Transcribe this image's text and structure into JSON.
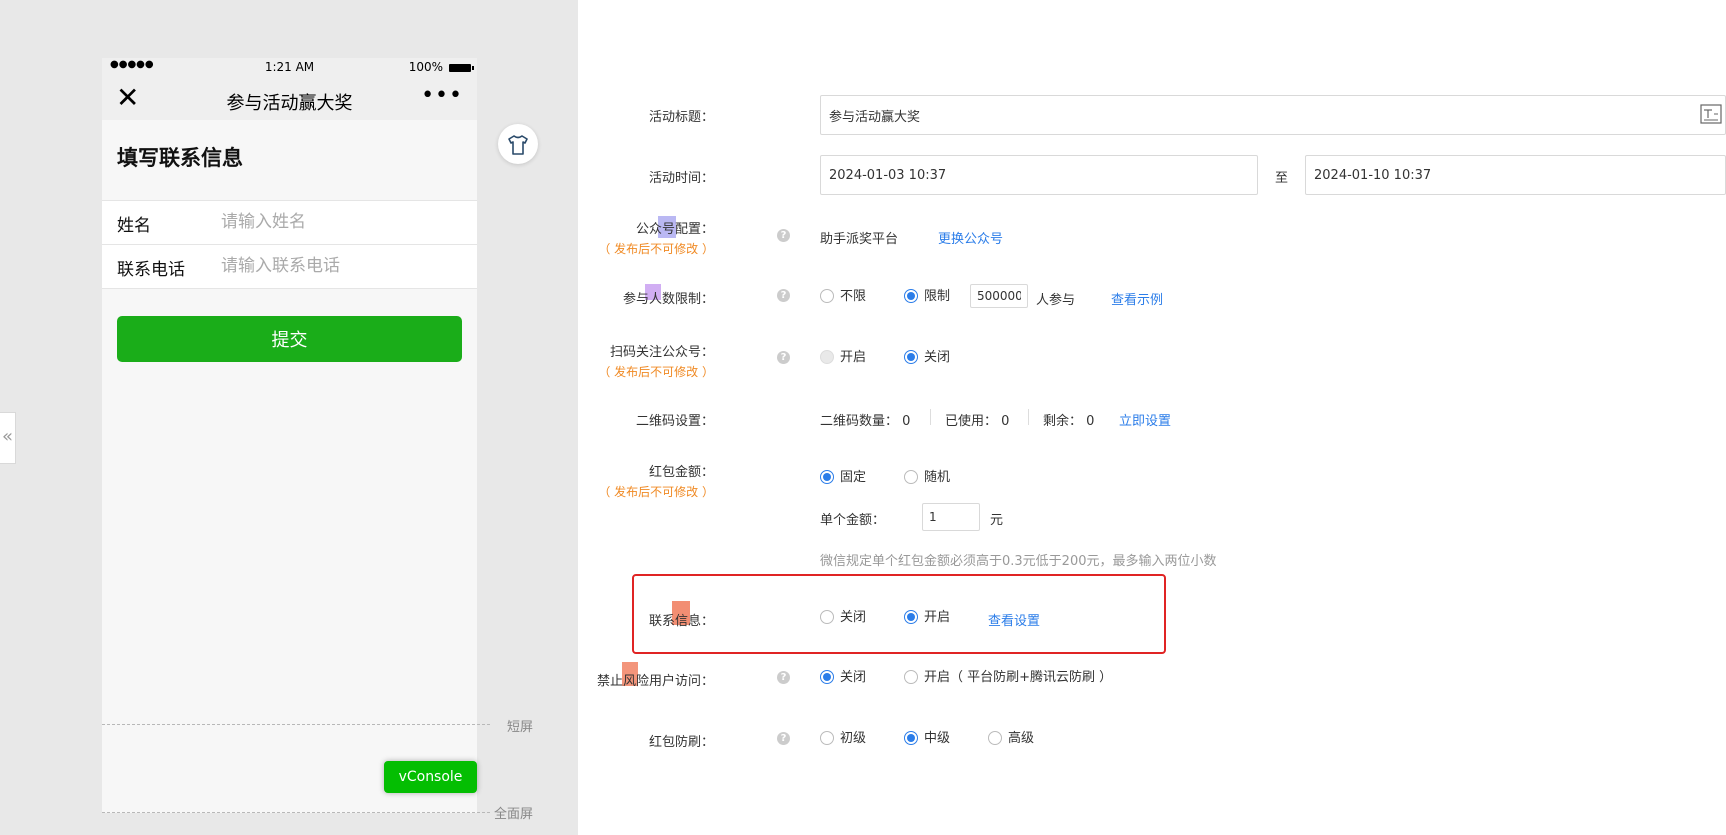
{
  "preview": {
    "status_bar": {
      "signal": "●●●●●",
      "time": "1:21 AM",
      "battery": "100%"
    },
    "nav": {
      "close_icon": "✕",
      "title": "参与活动赢大奖",
      "more_icon": "•••"
    },
    "form_title": "填写联系信息",
    "fields": [
      {
        "label": "姓名",
        "placeholder": "请输入姓名"
      },
      {
        "label": "联系电话",
        "placeholder": "请输入联系电话"
      }
    ],
    "submit_label": "提交",
    "vconsole_label": "vConsole",
    "short_screen_label": "短屏",
    "full_screen_label": "全面屏",
    "collapse_icon": "«",
    "skin_icon": "shirt-icon"
  },
  "settings": {
    "title": {
      "label": "活动标题：",
      "value": "参与活动赢大奖"
    },
    "time": {
      "label": "活动时间：",
      "start": "2024-01-03 10:37",
      "sep": "至",
      "end": "2024-01-10 10:37"
    },
    "account": {
      "label": "公众号配置：",
      "sub": "（ 发布后不可修改 ）",
      "value": "助手派奖平台",
      "link": "更换公众号"
    },
    "limit": {
      "label": "参与人数限制：",
      "opt_unlimited": "不限",
      "opt_limited": "限制",
      "count": "500000",
      "suffix": "人参与",
      "link": "查看示例",
      "selected": "限制"
    },
    "follow": {
      "label": "扫码关注公众号：",
      "sub": "（ 发布后不可修改 ）",
      "opt_on": "开启",
      "opt_off": "关闭",
      "selected": "关闭"
    },
    "qrcode": {
      "label": "二维码设置：",
      "count_label": "二维码数量：",
      "count": "0",
      "used_label": "已使用：",
      "used": "0",
      "left_label": "剩余：",
      "left": "0",
      "link": "立即设置"
    },
    "amount": {
      "label": "红包金额：",
      "sub": "（ 发布后不可修改 ）",
      "opt_fixed": "固定",
      "opt_random": "随机",
      "selected": "固定",
      "single_label": "单个金额：",
      "single_value": "1",
      "unit": "元",
      "hint": "微信规定单个红包金额必须高于0.3元低于200元，最多输入两位小数"
    },
    "contact": {
      "label": "联系信息：",
      "opt_off": "关闭",
      "opt_on": "开启",
      "selected": "开启",
      "link": "查看设置"
    },
    "risk": {
      "label": "禁止风险用户访问：",
      "opt_off": "关闭",
      "opt_on": "开启（ 平台防刷+腾讯云防刷 ）",
      "selected": "关闭"
    },
    "antibrush": {
      "label": "红包防刷：",
      "opt_low": "初级",
      "opt_mid": "中级",
      "opt_high": "高级",
      "selected": "中级"
    }
  },
  "colors": {
    "accent": "#2b7de9",
    "submit": "#1aad19",
    "highlight": "#e02424",
    "warn": "#f08a24"
  }
}
